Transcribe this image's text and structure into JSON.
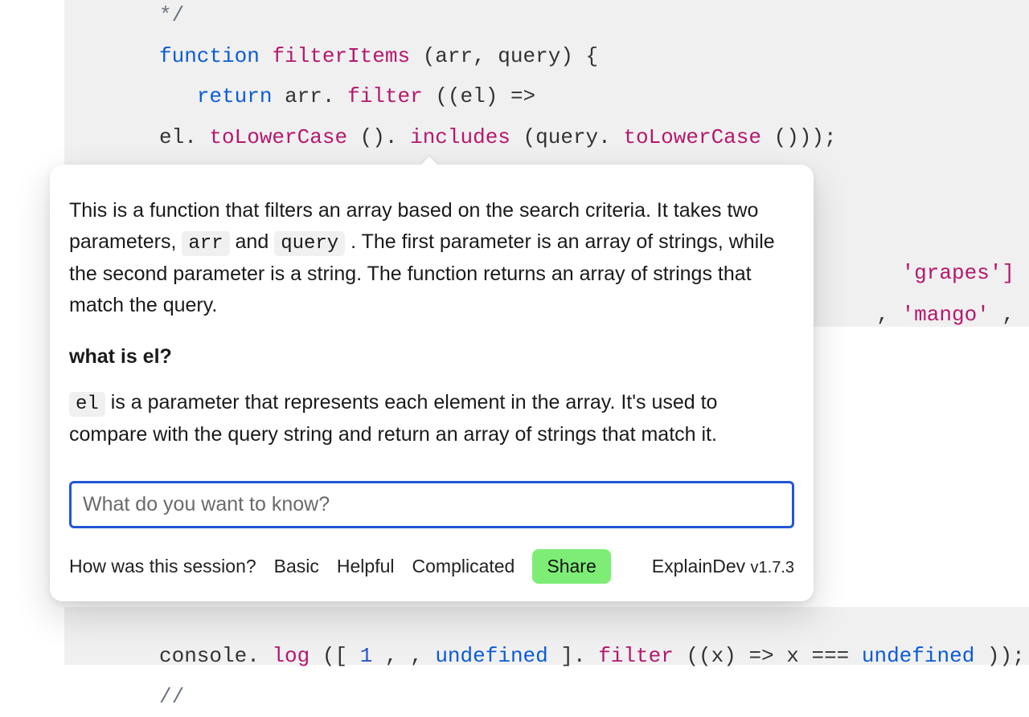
{
  "code_top": {
    "comment_close": " */",
    "kw_function": "function",
    "fn_name": "filterItems",
    "params_open": "(arr, query) {",
    "kw_return": "return",
    "after_return": " arr.",
    "m_filter": "filter",
    "after_filter": "((el) =>",
    "line3_pre": "el.",
    "m_toLower1": "toLowerCase",
    "after_tl1": "().",
    "m_includes": "includes",
    "after_incl": "(query.",
    "m_toLower2": "toLowerCase",
    "after_tl2": "()));",
    "bg_grapes": "'grapes']",
    "bg_mango_pre": ", ",
    "bg_mango": "'mango'",
    "bg_mango_post": ","
  },
  "code_bottom": {
    "pre": "console.",
    "m_log": "log",
    "after_log": "([",
    "num1": "1",
    "after_num": ", , ",
    "undef1": "undefined",
    "after_undef1": "].",
    "m_filter": "filter",
    "after_filter": "((x) => x === ",
    "undef2": "undefined",
    "after_undef2": ")); ",
    "comment": "//"
  },
  "popover": {
    "p1_a": "This is a function that filters an array based on the search criteria. It takes two parameters, ",
    "p1_code1": "arr",
    "p1_b": " and ",
    "p1_code2": "query",
    "p1_c": ". The first parameter is an array of strings, while the second parameter is a string. The function returns an array of strings that match the query.",
    "h4": "what is el?",
    "p2_code": "el",
    "p2_a": " is a parameter that represents each element in the array. It's used to compare with the query string and return an array of strings that match it.",
    "input_placeholder": "What do you want to know?"
  },
  "footer": {
    "question": "How was this session?",
    "opt_basic": "Basic",
    "opt_helpful": "Helpful",
    "opt_complicated": "Complicated",
    "share": "Share",
    "brand": "ExplainDev ",
    "version": "v1.7.3"
  }
}
